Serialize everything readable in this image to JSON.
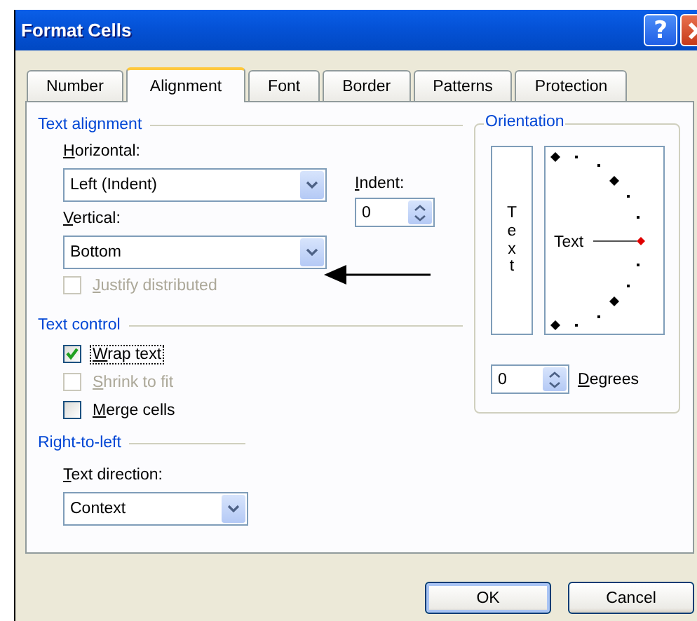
{
  "window": {
    "title": "Format Cells",
    "help_button": "?"
  },
  "tabs": [
    {
      "label": "Number",
      "selected": false
    },
    {
      "label": "Alignment",
      "selected": true
    },
    {
      "label": "Font",
      "selected": false
    },
    {
      "label": "Border",
      "selected": false
    },
    {
      "label": "Patterns",
      "selected": false
    },
    {
      "label": "Protection",
      "selected": false
    }
  ],
  "text_alignment": {
    "legend": "Text alignment",
    "horizontal": {
      "label": "Horizontal:",
      "value": "Left (Indent)"
    },
    "vertical": {
      "label": "Vertical:",
      "value": "Bottom"
    },
    "indent": {
      "label": "Indent:",
      "value": "0"
    }
  },
  "justify_distributed": {
    "label": "Justify distributed",
    "checked": false,
    "disabled": true
  },
  "text_control": {
    "legend": "Text control",
    "options": [
      {
        "label": "Wrap text",
        "checked": true,
        "disabled": false,
        "focused": true
      },
      {
        "label": "Shrink to fit",
        "checked": false,
        "disabled": true,
        "focused": false
      },
      {
        "label": "Merge cells",
        "checked": false,
        "disabled": false,
        "focused": false
      }
    ]
  },
  "right_to_left": {
    "legend": "Right-to-left",
    "text_direction": {
      "label": "Text direction:",
      "value": "Context"
    }
  },
  "orientation": {
    "legend": "Orientation",
    "vertical_text": "Text",
    "dial_text": "Text",
    "degrees": {
      "value": "0",
      "label": "Degrees"
    }
  },
  "buttons": [
    {
      "label": "OK",
      "default": true
    },
    {
      "label": "Cancel",
      "default": false
    }
  ]
}
